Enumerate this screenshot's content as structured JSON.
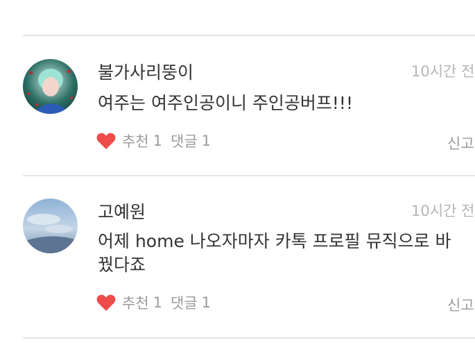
{
  "colors": {
    "heart": "#ef4b4b",
    "divider": "#e6e6e6",
    "meta_text": "#9b9b9b",
    "time_text": "#b5b5b5"
  },
  "comments": [
    {
      "nickname": "불가사리뚱이",
      "time": "10시간 전",
      "text": "여주는  여주인공이니  주인공버프!!!",
      "like_icon": "heart-icon",
      "like_label": "추천",
      "like_count": "1",
      "reply_label": "댓글",
      "reply_count": "1",
      "report_label": "신고"
    },
    {
      "nickname": "고예원",
      "time": "10시간 전",
      "text": "어제 home 나오자마자 카톡 프로필 뮤직으로 바꿨다죠",
      "like_icon": "heart-icon",
      "like_label": "추천",
      "like_count": "1",
      "reply_label": "댓글",
      "reply_count": "1",
      "report_label": "신고"
    }
  ]
}
